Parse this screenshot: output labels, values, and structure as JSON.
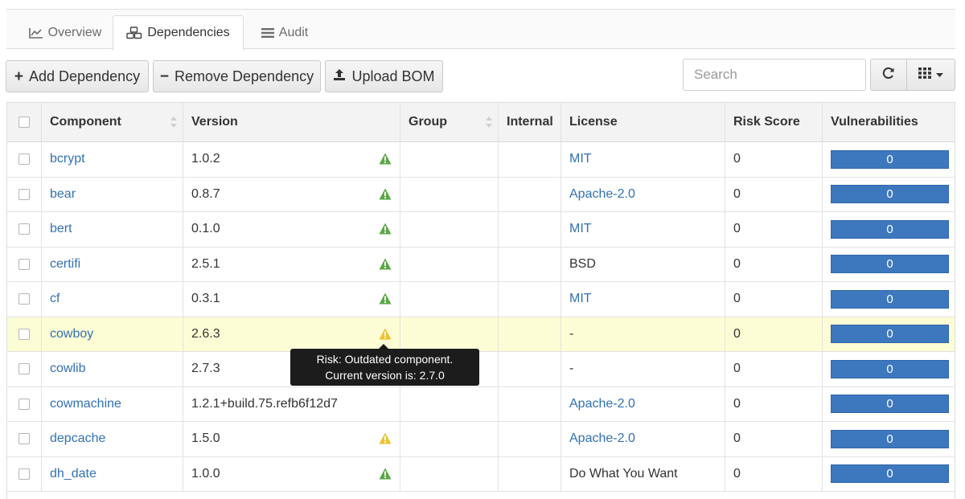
{
  "tabs": [
    {
      "label": "Overview",
      "icon": "line-chart-icon",
      "active": false
    },
    {
      "label": "Dependencies",
      "icon": "cubes-icon",
      "active": true
    },
    {
      "label": "Audit",
      "icon": "tasks-icon",
      "active": false
    }
  ],
  "toolbar": {
    "add_label": "Add Dependency",
    "remove_label": "Remove Dependency",
    "upload_label": "Upload BOM",
    "search_placeholder": "Search"
  },
  "table": {
    "columns": [
      "Component",
      "Version",
      "Group",
      "Internal",
      "License",
      "Risk Score",
      "Vulnerabilities"
    ],
    "rows": [
      {
        "component": "bcrypt",
        "version": "1.0.2",
        "group": "",
        "internal": "",
        "license": "MIT",
        "license_link": true,
        "risk": "0",
        "vulns": "0",
        "status": "ok"
      },
      {
        "component": "bear",
        "version": "0.8.7",
        "group": "",
        "internal": "",
        "license": "Apache-2.0",
        "license_link": true,
        "risk": "0",
        "vulns": "0",
        "status": "ok"
      },
      {
        "component": "bert",
        "version": "0.1.0",
        "group": "",
        "internal": "",
        "license": "MIT",
        "license_link": true,
        "risk": "0",
        "vulns": "0",
        "status": "ok"
      },
      {
        "component": "certifi",
        "version": "2.5.1",
        "group": "",
        "internal": "",
        "license": "BSD",
        "license_link": false,
        "risk": "0",
        "vulns": "0",
        "status": "ok"
      },
      {
        "component": "cf",
        "version": "0.3.1",
        "group": "",
        "internal": "",
        "license": "MIT",
        "license_link": true,
        "risk": "0",
        "vulns": "0",
        "status": "ok"
      },
      {
        "component": "cowboy",
        "version": "2.6.3",
        "group": "",
        "internal": "",
        "license": "-",
        "license_link": false,
        "risk": "0",
        "vulns": "0",
        "status": "outdated"
      },
      {
        "component": "cowlib",
        "version": "2.7.3",
        "group": "",
        "internal": "",
        "license": "-",
        "license_link": false,
        "risk": "0",
        "vulns": "0",
        "status": "none"
      },
      {
        "component": "cowmachine",
        "version": "1.2.1+build.75.refb6f12d7",
        "group": "",
        "internal": "",
        "license": "Apache-2.0",
        "license_link": true,
        "risk": "0",
        "vulns": "0",
        "status": "none"
      },
      {
        "component": "depcache",
        "version": "1.5.0",
        "group": "",
        "internal": "",
        "license": "Apache-2.0",
        "license_link": true,
        "risk": "0",
        "vulns": "0",
        "status": "outdated"
      },
      {
        "component": "dh_date",
        "version": "1.0.0",
        "group": "",
        "internal": "",
        "license": "Do What You Want",
        "license_link": false,
        "risk": "0",
        "vulns": "0",
        "status": "ok"
      }
    ]
  },
  "tooltip": {
    "line1": "Risk: Outdated component.",
    "line2": "Current version is: 2.7.0"
  },
  "colors": {
    "link": "#3271b3",
    "vuln_bar": "#3d78be",
    "ok_icon": "#5aa845",
    "warn_icon": "#f0c030",
    "highlight_row": "#fdfdd5"
  }
}
